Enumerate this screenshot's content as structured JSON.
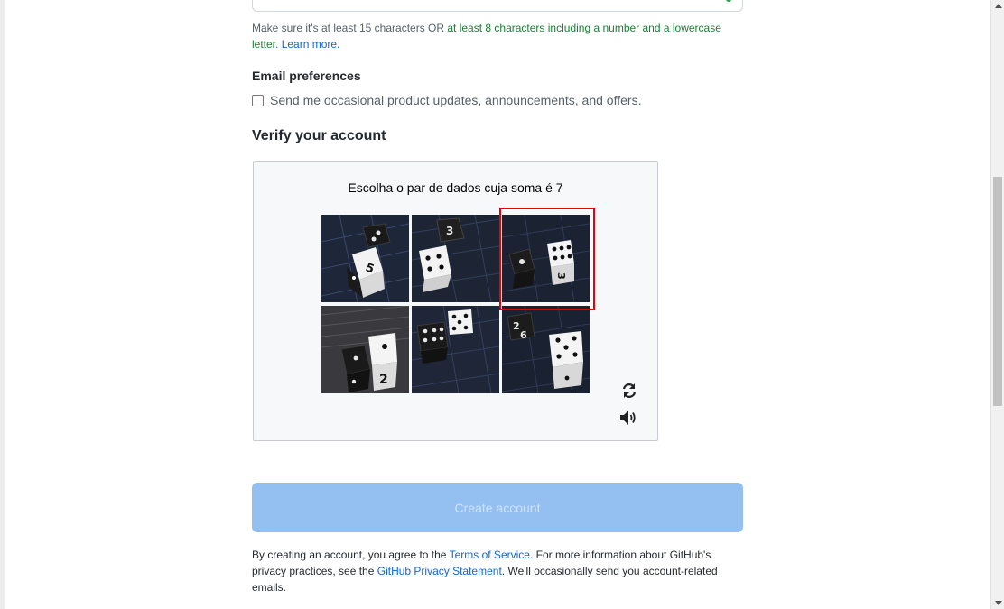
{
  "password_hint": {
    "part1": "Make sure it's at least 15 characters OR ",
    "ok_part": "at least 8 characters including a number and a lowercase letter",
    "part2": ". ",
    "learn_more": "Learn more."
  },
  "email_prefs": {
    "heading": "Email preferences",
    "checkbox_label": "Send me occasional product updates, announcements, and offers.",
    "checked": false
  },
  "verify": {
    "heading": "Verify your account",
    "captcha": {
      "prompt": "Escolha o par de dados cuja soma é 7",
      "tiles": [
        {
          "dice": [
            "dark with 2 pips visible",
            "white dice showing 5"
          ]
        },
        {
          "dice": [
            "dark dice showing 3",
            "white dice showing 4"
          ]
        },
        {
          "dice": [
            "dark dice showing 1",
            "white dice showing 6"
          ],
          "selected": true
        },
        {
          "dice": [
            "dark dice showing 1",
            "white dice showing 2"
          ]
        },
        {
          "dice": [
            "dark dice showing 6",
            "white dice showing 5"
          ]
        },
        {
          "dice": [
            "dark dice showing 2",
            "white dice showing 5"
          ]
        }
      ],
      "refresh_icon": "refresh-icon",
      "audio_icon": "audio-icon"
    }
  },
  "create_button": {
    "label": "Create account",
    "enabled": false
  },
  "legal": {
    "part1": "By creating an account, you agree to the ",
    "tos_link": "Terms of Service",
    "part2": ". For more information about GitHub's privacy practices, see the ",
    "privacy_link": "GitHub Privacy Statement",
    "part3": ". We'll occasionally send you account-related emails."
  }
}
